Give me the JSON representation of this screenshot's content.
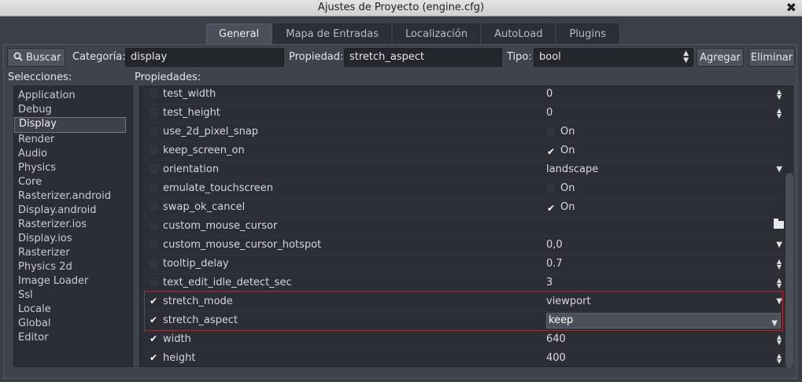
{
  "window": {
    "title": "Ajustes de Proyecto (engine.cfg)",
    "close_glyph": "✖"
  },
  "tabs": [
    {
      "label": "General",
      "active": true
    },
    {
      "label": "Mapa de Entradas",
      "active": false
    },
    {
      "label": "Localización",
      "active": false
    },
    {
      "label": "AutoLoad",
      "active": false
    },
    {
      "label": "Plugins",
      "active": false
    }
  ],
  "toolbar": {
    "search_icon": "search-icon",
    "search_label": "Buscar",
    "category_label": "Categoría:",
    "category_value": "display",
    "property_label": "Propiedad:",
    "property_value": "stretch_aspect",
    "type_label": "Tipo:",
    "type_value": "bool",
    "add_label": "Agregar",
    "remove_label": "Eliminar"
  },
  "sections": {
    "left": "Selecciones:",
    "right": "Propiedades:"
  },
  "categories": [
    "Application",
    "Debug",
    "Display",
    "Render",
    "Audio",
    "Physics",
    "Core",
    "Rasterizer.android",
    "Display.android",
    "Rasterizer.ios",
    "Display.ios",
    "Rasterizer",
    "Physics 2d",
    "Image Loader",
    "Ssl",
    "Locale",
    "Global",
    "Editor"
  ],
  "selected_category": "Display",
  "properties": [
    {
      "name": "test_width",
      "checked": false,
      "value": "0",
      "widget": "spin"
    },
    {
      "name": "test_height",
      "checked": false,
      "value": "0",
      "widget": "spin"
    },
    {
      "name": "use_2d_pixel_snap",
      "checked": false,
      "value": "On",
      "widget": "bool",
      "bool_on": false
    },
    {
      "name": "keep_screen_on",
      "checked": false,
      "value": "On",
      "widget": "bool",
      "bool_on": true
    },
    {
      "name": "orientation",
      "checked": false,
      "value": "landscape",
      "widget": "dropdown"
    },
    {
      "name": "emulate_touchscreen",
      "checked": false,
      "value": "On",
      "widget": "bool",
      "bool_on": false
    },
    {
      "name": "swap_ok_cancel",
      "checked": false,
      "value": "On",
      "widget": "bool",
      "bool_on": true
    },
    {
      "name": "custom_mouse_cursor",
      "checked": false,
      "value": "",
      "widget": "file"
    },
    {
      "name": "custom_mouse_cursor_hotspot",
      "checked": false,
      "value": "0,0",
      "widget": "dropdown"
    },
    {
      "name": "tooltip_delay",
      "checked": false,
      "value": "0.7",
      "widget": "spin"
    },
    {
      "name": "text_edit_idle_detect_sec",
      "checked": false,
      "value": "3",
      "widget": "spin"
    },
    {
      "name": "stretch_mode",
      "checked": true,
      "value": "viewport",
      "widget": "dropdown"
    },
    {
      "name": "stretch_aspect",
      "checked": true,
      "value": "keep",
      "widget": "editing"
    },
    {
      "name": "width",
      "checked": true,
      "value": "640",
      "widget": "spin"
    },
    {
      "name": "height",
      "checked": true,
      "value": "400",
      "widget": "spin"
    }
  ],
  "colors": {
    "highlight": "#c0222e",
    "background": "#3b3f48"
  }
}
